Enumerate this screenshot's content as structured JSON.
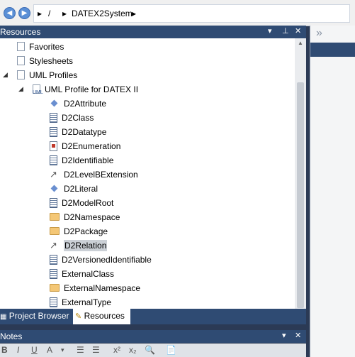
{
  "breadcrumb": {
    "back_icon": "◀",
    "forward_icon": "▶",
    "items": [
      " / ",
      "DATEX2System"
    ]
  },
  "resources_panel": {
    "title": "Resources",
    "dropdown_icon": "▾",
    "pin_icon": "📌",
    "close_icon": "✕"
  },
  "tree": [
    {
      "label": "Favorites",
      "icon": "favorites-icon",
      "level": 1
    },
    {
      "label": "Stylesheets",
      "icon": "stylesheet-icon",
      "level": 1
    },
    {
      "label": "UML Profiles",
      "icon": "folder-uml-icon",
      "level": 1,
      "expanded": true
    },
    {
      "label": "UML Profile for DATEX II",
      "icon": "uml-profile-icon",
      "level": 2,
      "expanded": true
    },
    {
      "label": "D2Attribute",
      "icon": "attribute-icon",
      "level": 3
    },
    {
      "label": "D2Class",
      "icon": "class-icon",
      "level": 3
    },
    {
      "label": "D2Datatype",
      "icon": "class-icon",
      "level": 3
    },
    {
      "label": "D2Enumeration",
      "icon": "enumeration-icon",
      "level": 3
    },
    {
      "label": "D2Identifiable",
      "icon": "class-icon",
      "level": 3
    },
    {
      "label": "D2LevelBExtension",
      "icon": "association-icon",
      "level": 3
    },
    {
      "label": "D2Literal",
      "icon": "attribute-icon",
      "level": 3
    },
    {
      "label": "D2ModelRoot",
      "icon": "class-icon",
      "level": 3
    },
    {
      "label": "D2Namespace",
      "icon": "package-icon",
      "level": 3
    },
    {
      "label": "D2Package",
      "icon": "package-icon",
      "level": 3
    },
    {
      "label": "D2Relation",
      "icon": "association-icon",
      "level": 3,
      "selected": true
    },
    {
      "label": "D2VersionedIdentifiable",
      "icon": "class-icon",
      "level": 3
    },
    {
      "label": "ExternalClass",
      "icon": "class-icon",
      "level": 3
    },
    {
      "label": "ExternalNamespace",
      "icon": "package-icon",
      "level": 3
    },
    {
      "label": "ExternalType",
      "icon": "class-icon",
      "level": 3
    }
  ],
  "tabs": [
    {
      "label": "Project Browser",
      "active": false
    },
    {
      "label": "Resources",
      "active": true
    }
  ],
  "notes_panel": {
    "title": "Notes",
    "dropdown_icon": "▾",
    "close_icon": "✕"
  },
  "notes_toolbar": [
    "B",
    "I",
    "U",
    "A",
    "▾",
    "☰",
    "☰",
    "x²",
    "x₂",
    "🔍",
    "📄"
  ],
  "right_dock": {
    "chevron": "»"
  },
  "colors": {
    "title_bar": "#2f4b73",
    "selected_bg": "#cbd0d6",
    "accent": "#5a8fd6"
  }
}
